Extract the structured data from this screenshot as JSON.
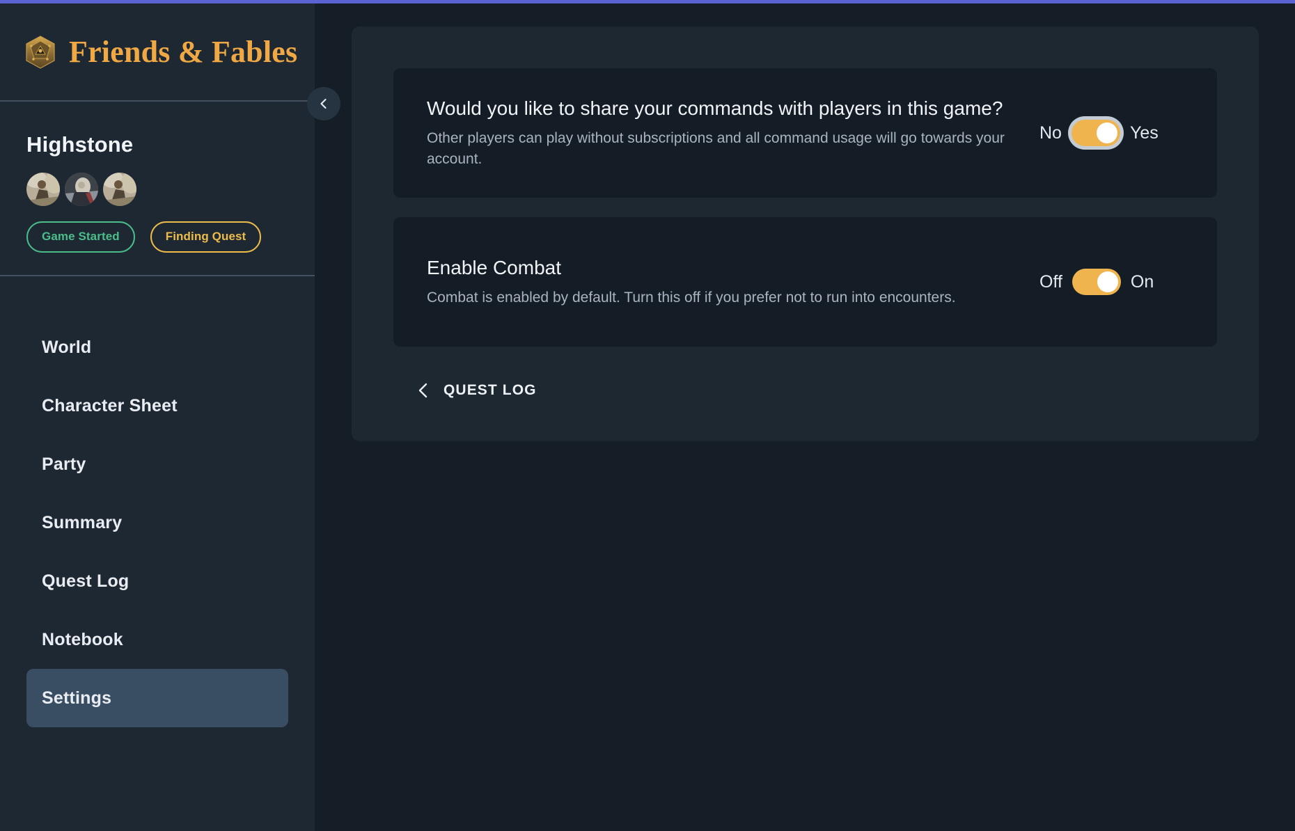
{
  "brand": {
    "title": "Friends & Fables",
    "logo_icon": "d20-dice-icon",
    "accent_color": "#efa844"
  },
  "top_accent": {
    "color": "#5b63d3"
  },
  "sidebar": {
    "collapse_icon": "chevron-left-icon",
    "game": {
      "name": "Highstone",
      "avatars": [
        {
          "name": "party-member-avatar-1"
        },
        {
          "name": "party-member-avatar-2"
        },
        {
          "name": "party-member-avatar-3"
        }
      ],
      "badges": [
        {
          "label": "Game Started",
          "color": "#4bbd8a"
        },
        {
          "label": "Finding Quest",
          "color": "#edbb4a"
        }
      ]
    },
    "nav_items": [
      {
        "label": "World",
        "active": false
      },
      {
        "label": "Character Sheet",
        "active": false
      },
      {
        "label": "Party",
        "active": false
      },
      {
        "label": "Summary",
        "active": false
      },
      {
        "label": "Quest Log",
        "active": false
      },
      {
        "label": "Notebook",
        "active": false
      },
      {
        "label": "Settings",
        "active": true
      }
    ],
    "active_item_color": "#3a4e63"
  },
  "main": {
    "settings": [
      {
        "title": "Would you like to share your commands with players in this game?",
        "description": "Other players can play without subscriptions and all command usage will go towards your account.",
        "toggle": {
          "off_label": "No",
          "on_label": "Yes",
          "state": "on",
          "focused": true,
          "on_color": "#efb44e"
        }
      },
      {
        "title": "Enable Combat",
        "description": "Combat is enabled by default. Turn this off if you prefer not to run into encounters.",
        "toggle": {
          "off_label": "Off",
          "on_label": "On",
          "state": "on",
          "focused": false,
          "on_color": "#efb44e"
        }
      }
    ],
    "back_link": {
      "label": "QUEST LOG",
      "icon": "chevron-left-icon"
    }
  }
}
